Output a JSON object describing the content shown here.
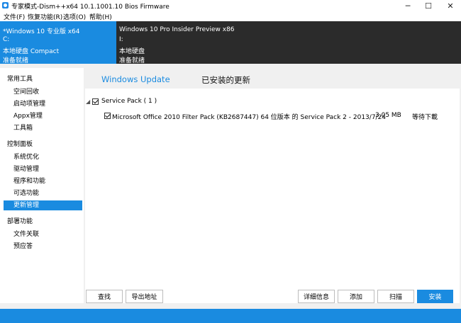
{
  "window": {
    "title": "专家模式-Dism++x64 10.1.1001.10 Bios Firmware",
    "minimize": "─",
    "maximize": "☐",
    "close": "✕"
  },
  "menu": [
    "文件(F)",
    "恢复功能(R)",
    "选项(O)",
    "帮助(H)"
  ],
  "images": [
    {
      "name": "*Windows 10 专业版 x64",
      "drive": "C:",
      "type": "本地硬盘 Compact",
      "status": "准备就绪"
    },
    {
      "name": "Windows 10 Pro Insider Preview x86",
      "drive": "I:",
      "type": "本地硬盘",
      "status": "准备就绪"
    }
  ],
  "sidebar": {
    "groups": [
      {
        "label": "常用工具",
        "items": [
          "空间回收",
          "启动项管理",
          "Appx管理",
          "工具箱"
        ]
      },
      {
        "label": "控制面板",
        "items": [
          "系统优化",
          "驱动管理",
          "程序和功能",
          "可选功能",
          "更新管理"
        ]
      },
      {
        "label": "部署功能",
        "items": [
          "文件关联",
          "预应答"
        ]
      }
    ],
    "active": "更新管理"
  },
  "tabs": {
    "windows_update": "Windows Update",
    "installed": "已安装的更新"
  },
  "list": {
    "group_label": "Service Pack ( 1 )",
    "item": {
      "name": "Microsoft Office 2010 Filter Pack (KB2687447) 64 位版本 的 Service Pack 2 - 2013/7/24",
      "size": "3.05 MB",
      "status": "等待下載"
    }
  },
  "buttons": {
    "search": "查找",
    "export": "导出地址",
    "details": "详细信息",
    "add": "添加",
    "scan": "扫描",
    "install": "安装"
  },
  "colors": {
    "accent": "#1a8be0",
    "dark_panel": "#2b2b2b"
  }
}
